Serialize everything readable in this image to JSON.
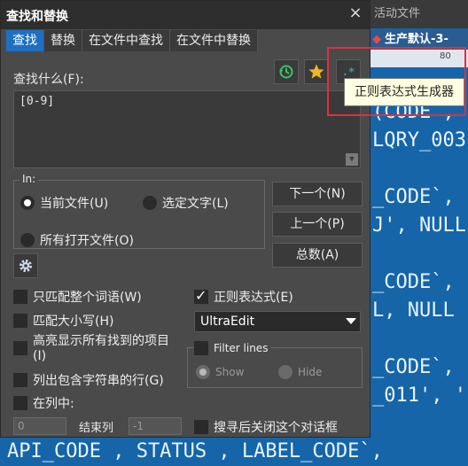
{
  "background": {
    "top_text": "活动文件",
    "tab_text": "生产默认-3-",
    "ruler_label": "80",
    "lines": [
      "(CODE ,",
      "LQRY_003",
      "_CODE`,",
      "J', NULL",
      "_CODE`,",
      "L, NULL",
      "_CODE`,",
      "_011', '"
    ],
    "bottom_line": "API_CODE , STATUS , LABEL_CODE`,"
  },
  "dialog": {
    "title": "查找和替换",
    "close_symbol": "×",
    "tabs": [
      "查找",
      "替换",
      "在文件中查找",
      "在文件中替换"
    ],
    "find_label": "查找什么(F):",
    "find_value": "[0-9]",
    "regex_builder_symbol": ".*",
    "tooltip": "正则表达式生成器",
    "in_label": "In:",
    "radio_current_file": "当前文件(U)",
    "radio_selected_text": "选定文字(L)",
    "radio_all_open_files": "所有打开文件(O)",
    "btn_next": "下一个(N)",
    "btn_prev": "上一个(P)",
    "btn_count": "总数(A)",
    "chk_whole_word": "只匹配整个词语(W)",
    "chk_regex": "正则表达式(E)",
    "chk_match_case": "匹配大小写(H)",
    "regex_engine": "UltraEdit",
    "chk_highlight_all": "高亮显示所有找到的项目",
    "chk_highlight_all_key": "(I)",
    "filter_lines_label": "Filter lines",
    "radio_show": "Show",
    "radio_hide": "Hide",
    "chk_list_lines": "列出包含字符串的行(G)",
    "chk_in_column": "在列中:",
    "start_col": "0",
    "end_col_label": "结束列",
    "end_col": "-1",
    "chk_close_after": "搜寻后关闭这个对话框"
  },
  "colors": {
    "accent": "#1f6fc1",
    "highlight_border": "#e0303a",
    "history_icon": "#3fbf6a",
    "star_icon": "#f0b429",
    "regex_icon": "#2fa3a0"
  }
}
